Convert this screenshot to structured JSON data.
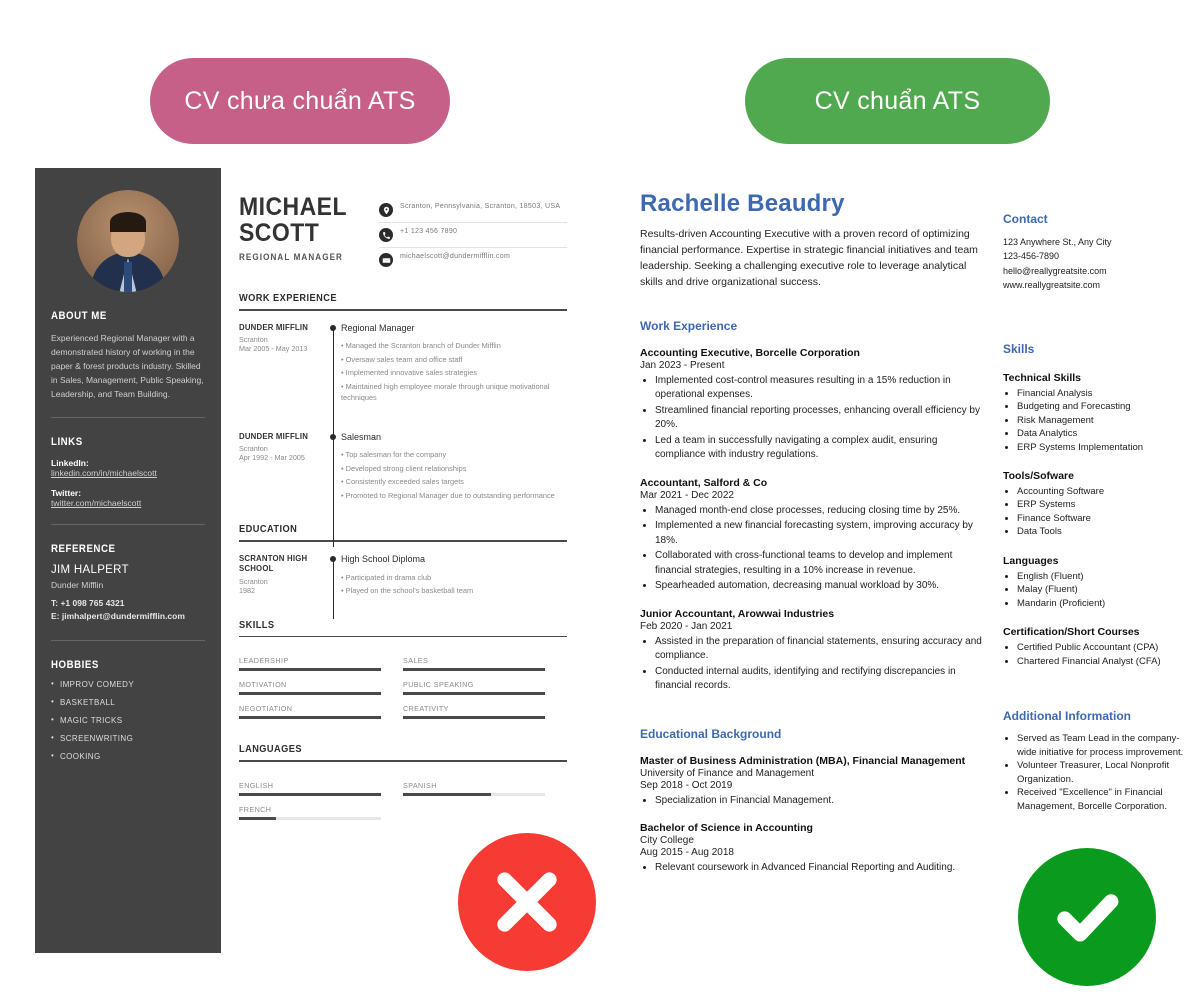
{
  "headers": {
    "bad_label": "CV chưa chuẩn ATS",
    "good_label": "CV chuẩn ATS",
    "bad_color": "#c66089",
    "good_color": "#51a94f"
  },
  "badges": {
    "x_icon": "cross-mark-icon",
    "check_icon": "check-mark-icon",
    "x_color": "#f53b33",
    "check_color": "#0a9a1e"
  },
  "cv_bad": {
    "sidebar": {
      "avatar_alt": "portrait-photo",
      "about_heading": "ABOUT ME",
      "about_text": "Experienced Regional Manager with a demonstrated history of working in the paper & forest products industry. Skilled in Sales, Management, Public Speaking, Leadership, and Team Building.",
      "links_heading": "LINKS",
      "links": [
        {
          "label": "LinkedIn:",
          "url": "linkedin.com/in/michaelscott"
        },
        {
          "label": "Twitter:",
          "url": "twitter.com/michaelscott"
        }
      ],
      "reference_heading": "REFERENCE",
      "reference_name": "JIM HALPERT",
      "reference_company": "Dunder Mifflin",
      "reference_phone": "T: +1 098 765 4321",
      "reference_email": "E: jimhalpert@dundermifflin.com",
      "hobbies_heading": "HOBBIES",
      "hobbies": [
        "IMPROV COMEDY",
        "BASKETBALL",
        "MAGIC TRICKS",
        "SCREENWRITING",
        "COOKING"
      ]
    },
    "name_line1": "MICHAEL",
    "name_line2": "SCOTT",
    "role": "REGIONAL MANAGER",
    "contacts": [
      {
        "icon": "location-pin-icon",
        "text": "Scranton, Pennsylvania, Scranton, 18503, USA"
      },
      {
        "icon": "phone-icon",
        "text": "+1 123 456 7890"
      },
      {
        "icon": "envelope-icon",
        "text": "michaelscott@dundermifflin.com"
      }
    ],
    "work_heading": "WORK EXPERIENCE",
    "jobs": [
      {
        "company": "DUNDER MIFFLIN",
        "city": "Scranton",
        "dates": "Mar 2005 - May 2013",
        "title": "Regional Manager",
        "bullets": [
          "• Managed the Scranton branch of Dunder Mifflin",
          "• Oversaw sales team and office staff",
          "• Implemented innovative sales strategies",
          "• Maintained high employee morale through unique motivational techniques"
        ]
      },
      {
        "company": "DUNDER MIFFLIN",
        "city": "Scranton",
        "dates": "Apr 1992 - Mar 2005",
        "title": "Salesman",
        "bullets": [
          "• Top salesman for the company",
          "• Developed strong client relationships",
          "• Consistently exceeded sales targets",
          "• Promoted to Regional Manager due to outstanding performance"
        ]
      }
    ],
    "education_heading": "EDUCATION",
    "education": {
      "school": "SCRANTON HIGH SCHOOL",
      "city": "Scranton",
      "year": "1982",
      "title": "High School Diploma",
      "bullets": [
        "• Participated in drama club",
        "• Played on the school's basketball team"
      ]
    },
    "skills_heading": "SKILLS",
    "skills": [
      {
        "name": "LEADERSHIP",
        "pct": 100
      },
      {
        "name": "SALES",
        "pct": 100
      },
      {
        "name": "MOTIVATION",
        "pct": 100
      },
      {
        "name": "PUBLIC SPEAKING",
        "pct": 100
      },
      {
        "name": "NEGOTIATION",
        "pct": 100
      },
      {
        "name": "CREATIVITY",
        "pct": 100
      }
    ],
    "languages_heading": "LANGUAGES",
    "languages": [
      {
        "name": "ENGLISH",
        "pct": 100
      },
      {
        "name": "SPANISH",
        "pct": 62
      },
      {
        "name": "FRENCH",
        "pct": 26
      }
    ]
  },
  "cv_good": {
    "name": "Rachelle Beaudry",
    "summary": "Results-driven Accounting Executive with a proven record of optimizing financial performance. Expertise in strategic financial initiatives and team leadership. Seeking a challenging executive role to leverage analytical skills and drive organizational success.",
    "contact_heading": "Contact",
    "contact_lines": [
      "123 Anywhere St., Any City",
      "123-456-7890",
      "hello@reallygreatsite.com",
      "www.reallygreatsite.com"
    ],
    "work_heading": "Work Experience",
    "jobs": [
      {
        "title": "Accounting Executive, Borcelle Corporation",
        "dates": "Jan 2023 - Present",
        "bullets": [
          "Implemented cost-control measures resulting in a 15% reduction in operational expenses.",
          "Streamlined financial reporting processes, enhancing overall efficiency by 20%.",
          "Led a team in successfully navigating a complex audit, ensuring compliance with industry regulations."
        ]
      },
      {
        "title": "Accountant, Salford & Co",
        "dates": "Mar 2021 - Dec 2022",
        "bullets": [
          "Managed month-end close processes, reducing closing time by 25%.",
          "Implemented a new financial forecasting system, improving accuracy by 18%.",
          "Collaborated with cross-functional teams to develop and implement financial strategies, resulting in a 10% increase in revenue.",
          "Spearheaded automation, decreasing manual workload by 30%."
        ]
      },
      {
        "title": "Junior Accountant, Arowwai Industries",
        "dates": "Feb 2020 - Jan 2021",
        "bullets": [
          "Assisted in the preparation of financial statements, ensuring accuracy and compliance.",
          "Conducted internal audits, identifying and rectifying discrepancies in financial records."
        ]
      }
    ],
    "skills_heading": "Skills",
    "skill_groups": [
      {
        "title": "Technical Skills",
        "items": [
          "Financial Analysis",
          "Budgeting and Forecasting",
          "Risk Management",
          "Data Analytics",
          "ERP Systems Implementation"
        ]
      },
      {
        "title": "Tools/Sofware",
        "items": [
          "Accounting Software",
          "ERP Systems",
          "Finance Software",
          "Data Tools"
        ]
      },
      {
        "title": "Languages",
        "items": [
          "English (Fluent)",
          "Malay (Fluent)",
          "Mandarin (Proficient)"
        ]
      },
      {
        "title": "Certification/Short Courses",
        "items": [
          "Certified Public Accountant (CPA)",
          "Chartered Financial Analyst (CFA)"
        ]
      }
    ],
    "education_heading": "Educational Background",
    "education": [
      {
        "degree": "Master of Business Administration (MBA), Financial Management",
        "school": "University of Finance and Management",
        "dates": "Sep 2018 - Oct 2019",
        "bullets": [
          "Specialization in Financial Management."
        ]
      },
      {
        "degree": "Bachelor of Science in Accounting",
        "school": "City College",
        "dates": "Aug 2015 - Aug 2018",
        "bullets": [
          "Relevant coursework in Advanced Financial Reporting and Auditing."
        ]
      }
    ],
    "additional_heading": "Additional Information",
    "additional": [
      "Served as Team Lead in the company-wide initiative for process improvement.",
      "Volunteer Treasurer, Local Nonprofit Organization.",
      "Received \"Excellence\" in Financial Management, Borcelle Corporation."
    ]
  }
}
